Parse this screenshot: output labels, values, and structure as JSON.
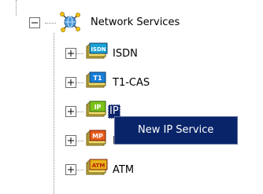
{
  "tree": {
    "root": {
      "label": "Network Services",
      "icon": "network-globe-icon",
      "expanded": true
    },
    "children": [
      {
        "id": "isdn",
        "label": "ISDN",
        "badge": "ISDN",
        "icon": "isdn-folder-icon",
        "badge_color": "#1aa2d8"
      },
      {
        "id": "t1cas",
        "label": "T1-CAS",
        "badge": "T1",
        "icon": "t1-folder-icon",
        "badge_color": "#1a7ed8"
      },
      {
        "id": "ip",
        "label": "IP",
        "badge": "IP",
        "icon": "ip-folder-icon",
        "badge_color": "#7cc21a"
      },
      {
        "id": "mpls",
        "label": "MPLS",
        "badge": "MP",
        "icon": "mpls-folder-icon",
        "badge_color": "#e85a1a"
      },
      {
        "id": "atm",
        "label": "ATM",
        "badge": "ATM",
        "icon": "atm-folder-icon",
        "badge_color": "#e8b21a"
      }
    ]
  },
  "context_menu": {
    "items": [
      {
        "label": "New IP Service"
      }
    ]
  }
}
